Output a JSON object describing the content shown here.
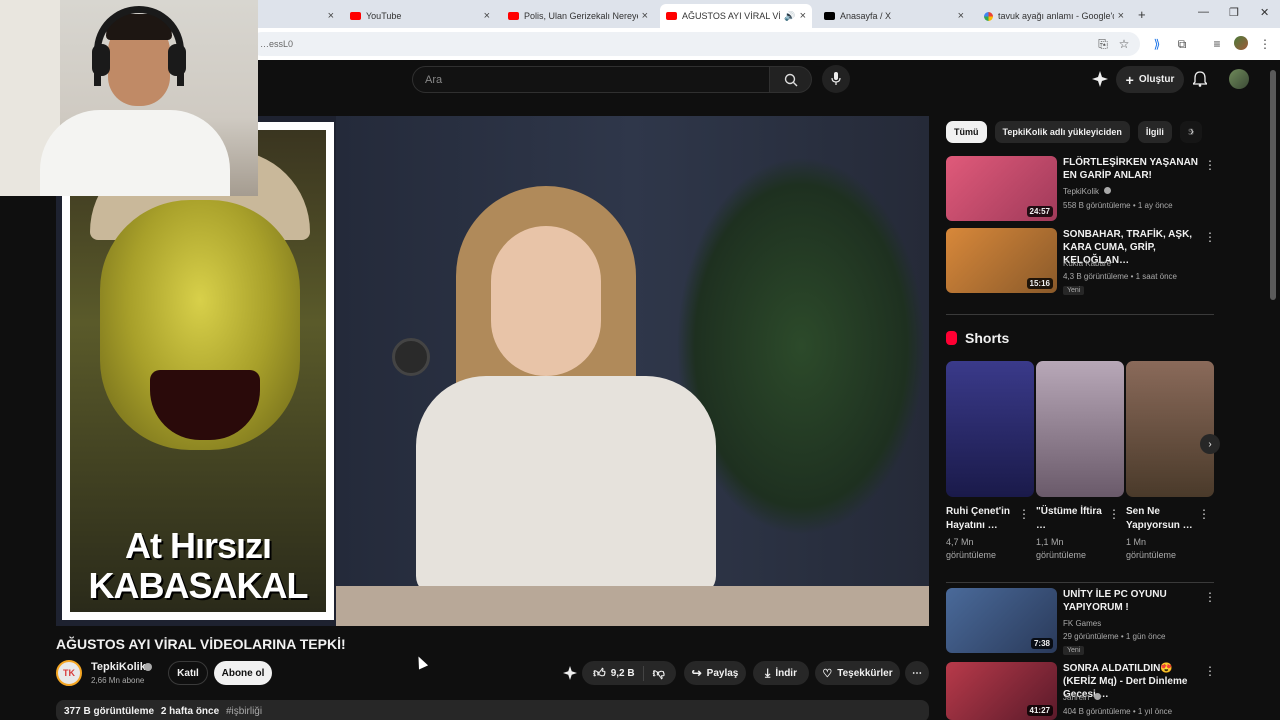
{
  "browser": {
    "tabs": [
      {
        "title": "",
        "icon": "blank"
      },
      {
        "title": "YouTube",
        "icon": "youtube"
      },
      {
        "title": "Polis, Ulan Gerizekalı Nereye Al",
        "icon": "youtube"
      },
      {
        "title": "AĞUSTOS AYI VİRAL VİDEO",
        "icon": "youtube",
        "active": true
      },
      {
        "title": "Anasayfa / X",
        "icon": "x"
      },
      {
        "title": "tavuk ayağı anlamı - Google'da",
        "icon": "google"
      }
    ],
    "address": "…essL0",
    "new_tab": "+"
  },
  "youtube": {
    "search_placeholder": "Ara",
    "create_label": "Oluştur"
  },
  "video": {
    "thumbnail_caption_line1": "At Hırsızı",
    "thumbnail_caption_line2": "KABASAKAL",
    "title": "AĞUSTOS AYI VİRAL VİDEOLARINA TEPKİ!",
    "channel_initials": "TK",
    "channel_name": "TepkiKolik",
    "subscribers": "2,66 Mn abone",
    "join_label": "Katıl",
    "subscribe_label": "Abone ol",
    "likes": "9,2 B",
    "share_label": "Paylaş",
    "download_label": "İndir",
    "thanks_label": "Teşekkürler",
    "views": "377 B görüntüleme",
    "posted": "2 hafta önce",
    "hashtag": "#işbirliği"
  },
  "chips": [
    "Tümü",
    "TepkiKolik adlı yükleyiciden",
    "İlgili",
    "S"
  ],
  "recommendations": [
    {
      "title": "FLÖRTLEŞİRKEN YAŞANAN EN GARİP ANLAR!",
      "channel": "TepkiKolik",
      "verified": true,
      "meta": "558 B görüntüleme • 1 ay önce",
      "duration": "24:57",
      "badge": "",
      "thumb_color": "#c64a6a"
    },
    {
      "title": "SONBAHAR, TRAFİK, AŞK, KARA CUMA, GRİP, KELOĞLAN…",
      "channel": "Kukla Kabare",
      "verified": false,
      "meta": "4,3 B görüntüleme • 1 saat önce",
      "duration": "15:16",
      "badge": "Yeni",
      "thumb_color": "#b87a3a"
    }
  ],
  "shorts": {
    "heading": "Shorts",
    "items": [
      {
        "title": "Ruhi Çenet'in Hayatını …",
        "views": "4,7 Mn görüntüleme",
        "color": "#2a2a6a"
      },
      {
        "title": "\"Üstüme İftira …",
        "views": "1,1 Mn görüntüleme",
        "color": "#8a7a8a"
      },
      {
        "title": "Sen Ne Yapıyorsun …",
        "views": "1 Mn görüntüleme",
        "color": "#7a5a4a"
      }
    ]
  },
  "recommendations2": [
    {
      "title": "UNİTY İLE PC OYUNU YAPIYORUM !",
      "channel": "FK Games",
      "verified": false,
      "meta": "29 görüntüleme • 1 gün önce",
      "duration": "7:38",
      "badge": "Yeni",
      "thumb_color": "#3a5a8a"
    },
    {
      "title": "SONRA ALDATILDIN😍(KERİZ Mq) - Dert Dinleme Gecesi …",
      "channel": "Jahrein",
      "verified": true,
      "meta": "404 B görüntüleme • 1 yıl önce",
      "duration": "41:27",
      "badge": "",
      "thumb_color": "#8a2a3a"
    }
  ]
}
